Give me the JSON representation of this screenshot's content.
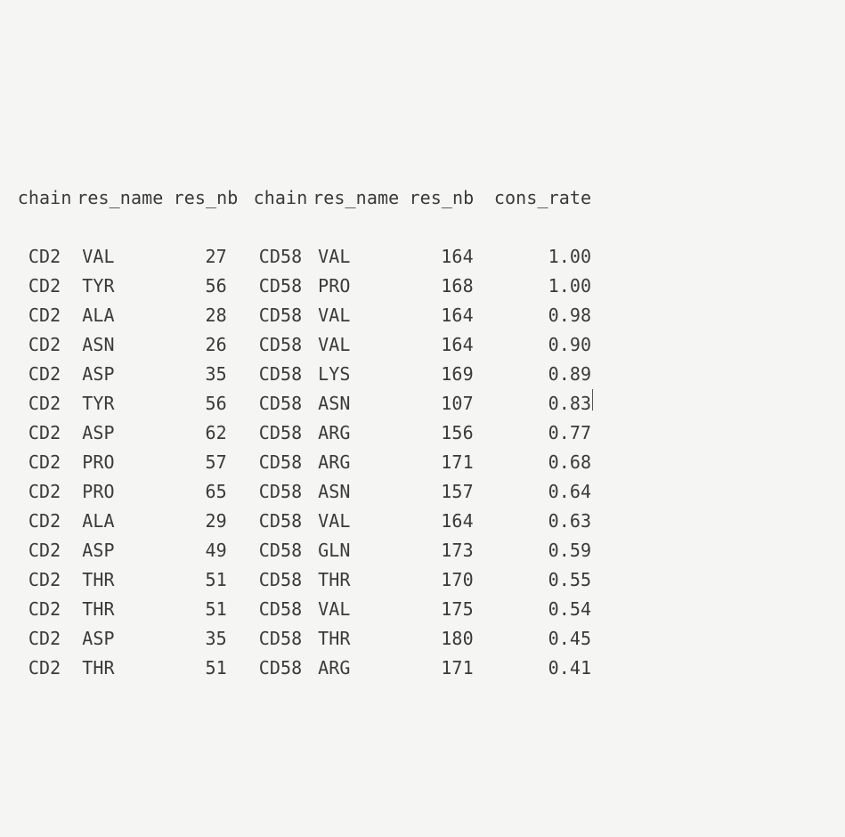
{
  "headers": {
    "c1": "chain",
    "c2": "res_name",
    "c3": "res_nb",
    "c4": "chain",
    "c5": "res_name",
    "c6": "res_nb",
    "c7": "cons_rate"
  },
  "rows": [
    {
      "c1": "CD2",
      "c2": "VAL",
      "c3": "27",
      "c4": "CD58",
      "c5": "VAL",
      "c6": "164",
      "c7": "1.00",
      "cursor": false
    },
    {
      "c1": "CD2",
      "c2": "TYR",
      "c3": "56",
      "c4": "CD58",
      "c5": "PRO",
      "c6": "168",
      "c7": "1.00",
      "cursor": false
    },
    {
      "c1": "CD2",
      "c2": "ALA",
      "c3": "28",
      "c4": "CD58",
      "c5": "VAL",
      "c6": "164",
      "c7": "0.98",
      "cursor": false
    },
    {
      "c1": "CD2",
      "c2": "ASN",
      "c3": "26",
      "c4": "CD58",
      "c5": "VAL",
      "c6": "164",
      "c7": "0.90",
      "cursor": false
    },
    {
      "c1": "CD2",
      "c2": "ASP",
      "c3": "35",
      "c4": "CD58",
      "c5": "LYS",
      "c6": "169",
      "c7": "0.89",
      "cursor": false
    },
    {
      "c1": "CD2",
      "c2": "TYR",
      "c3": "56",
      "c4": "CD58",
      "c5": "ASN",
      "c6": "107",
      "c7": "0.83",
      "cursor": true
    },
    {
      "c1": "CD2",
      "c2": "ASP",
      "c3": "62",
      "c4": "CD58",
      "c5": "ARG",
      "c6": "156",
      "c7": "0.77",
      "cursor": false
    },
    {
      "c1": "CD2",
      "c2": "PRO",
      "c3": "57",
      "c4": "CD58",
      "c5": "ARG",
      "c6": "171",
      "c7": "0.68",
      "cursor": false
    },
    {
      "c1": "CD2",
      "c2": "PRO",
      "c3": "65",
      "c4": "CD58",
      "c5": "ASN",
      "c6": "157",
      "c7": "0.64",
      "cursor": false
    },
    {
      "c1": "CD2",
      "c2": "ALA",
      "c3": "29",
      "c4": "CD58",
      "c5": "VAL",
      "c6": "164",
      "c7": "0.63",
      "cursor": false
    },
    {
      "c1": "CD2",
      "c2": "ASP",
      "c3": "49",
      "c4": "CD58",
      "c5": "GLN",
      "c6": "173",
      "c7": "0.59",
      "cursor": false
    },
    {
      "c1": "CD2",
      "c2": "THR",
      "c3": "51",
      "c4": "CD58",
      "c5": "THR",
      "c6": "170",
      "c7": "0.55",
      "cursor": false
    },
    {
      "c1": "CD2",
      "c2": "THR",
      "c3": "51",
      "c4": "CD58",
      "c5": "VAL",
      "c6": "175",
      "c7": "0.54",
      "cursor": false
    },
    {
      "c1": "CD2",
      "c2": "ASP",
      "c3": "35",
      "c4": "CD58",
      "c5": "THR",
      "c6": "180",
      "c7": "0.45",
      "cursor": false
    },
    {
      "c1": "CD2",
      "c2": "THR",
      "c3": "51",
      "c4": "CD58",
      "c5": "ARG",
      "c6": "171",
      "c7": "0.41",
      "cursor": false
    }
  ],
  "chart_data": {
    "type": "table",
    "columns": [
      "chain",
      "res_name",
      "res_nb",
      "chain",
      "res_name",
      "res_nb",
      "cons_rate"
    ],
    "data": [
      [
        "CD2",
        "VAL",
        27,
        "CD58",
        "VAL",
        164,
        1.0
      ],
      [
        "CD2",
        "TYR",
        56,
        "CD58",
        "PRO",
        168,
        1.0
      ],
      [
        "CD2",
        "ALA",
        28,
        "CD58",
        "VAL",
        164,
        0.98
      ],
      [
        "CD2",
        "ASN",
        26,
        "CD58",
        "VAL",
        164,
        0.9
      ],
      [
        "CD2",
        "ASP",
        35,
        "CD58",
        "LYS",
        169,
        0.89
      ],
      [
        "CD2",
        "TYR",
        56,
        "CD58",
        "ASN",
        107,
        0.83
      ],
      [
        "CD2",
        "ASP",
        62,
        "CD58",
        "ARG",
        156,
        0.77
      ],
      [
        "CD2",
        "PRO",
        57,
        "CD58",
        "ARG",
        171,
        0.68
      ],
      [
        "CD2",
        "PRO",
        65,
        "CD58",
        "ASN",
        157,
        0.64
      ],
      [
        "CD2",
        "ALA",
        29,
        "CD58",
        "VAL",
        164,
        0.63
      ],
      [
        "CD2",
        "ASP",
        49,
        "CD58",
        "GLN",
        173,
        0.59
      ],
      [
        "CD2",
        "THR",
        51,
        "CD58",
        "THR",
        170,
        0.55
      ],
      [
        "CD2",
        "THR",
        51,
        "CD58",
        "VAL",
        175,
        0.54
      ],
      [
        "CD2",
        "ASP",
        35,
        "CD58",
        "THR",
        180,
        0.45
      ],
      [
        "CD2",
        "THR",
        51,
        "CD58",
        "ARG",
        171,
        0.41
      ]
    ]
  }
}
